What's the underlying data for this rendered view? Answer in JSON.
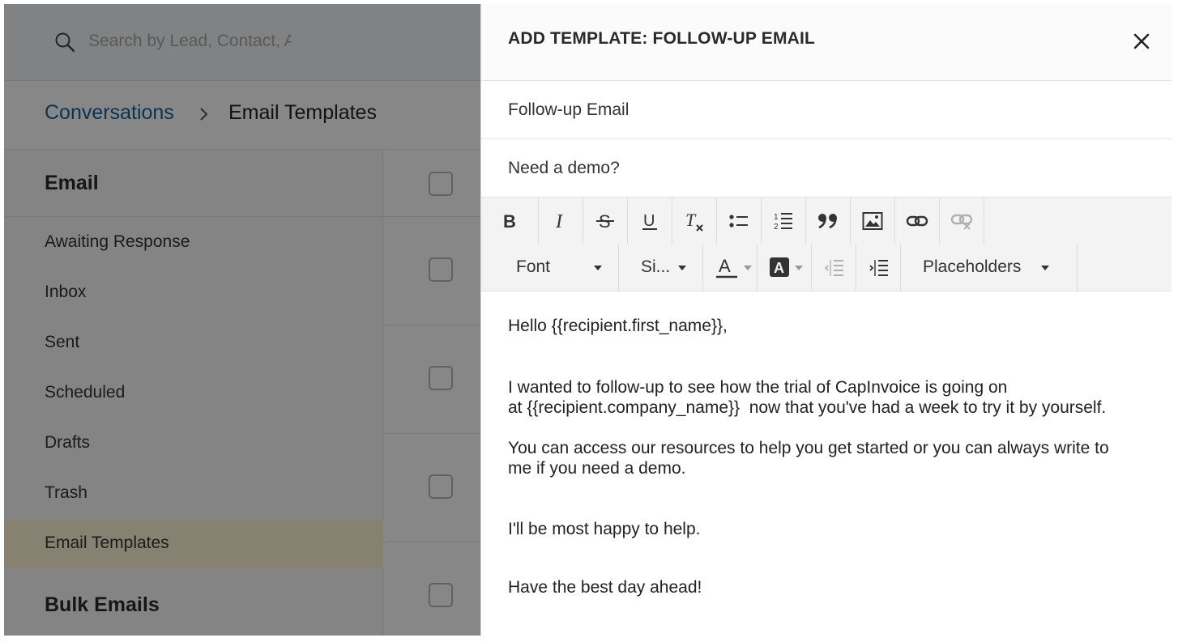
{
  "background_app": {
    "search": {
      "placeholder": "Search by Lead, Contact, Account"
    },
    "breadcrumb": {
      "parent": "Conversations",
      "current": "Email Templates"
    },
    "sidebar": {
      "section_title": "Email",
      "items": [
        {
          "label": "Awaiting Response"
        },
        {
          "label": "Inbox"
        },
        {
          "label": "Sent"
        },
        {
          "label": "Scheduled"
        },
        {
          "label": "Drafts"
        },
        {
          "label": "Trash"
        },
        {
          "label": "Email Templates",
          "active": true
        }
      ],
      "footer_section": "Bulk Emails"
    },
    "list_rows": 5
  },
  "modal": {
    "title": "ADD TEMPLATE: FOLLOW-UP EMAIL",
    "template_name": "Follow-up Email",
    "subject": "Need a demo?",
    "toolbar": {
      "formatting_icons": [
        "bold-icon",
        "italic-icon",
        "strikethrough-icon",
        "underline-icon",
        "clear-format-icon",
        "bullet-list-icon",
        "numbered-list-icon",
        "blockquote-icon",
        "image-icon",
        "link-icon",
        "unlink-icon"
      ],
      "font_label": "Font",
      "size_label": "Si...",
      "placeholders_label": "Placeholders"
    },
    "body": {
      "greeting": "Hello {{recipient.first_name}},",
      "para1_line1": "I wanted to follow-up to see how the trial of CapInvoice is going on",
      "para1_line2": "at {{recipient.company_name}}  now that you've had a week to try it by yourself.",
      "para2_line1": "You can access our resources to help you get started or you can always write to",
      "para2_line2": "me if you need a demo.",
      "para3": "I'll be most happy to help.",
      "closing": "Have the best day ahead!"
    }
  },
  "colors": {
    "link": "#16629c",
    "overlay": "rgba(0,0,0,0.47)",
    "active_nav": "#fff3d7"
  }
}
